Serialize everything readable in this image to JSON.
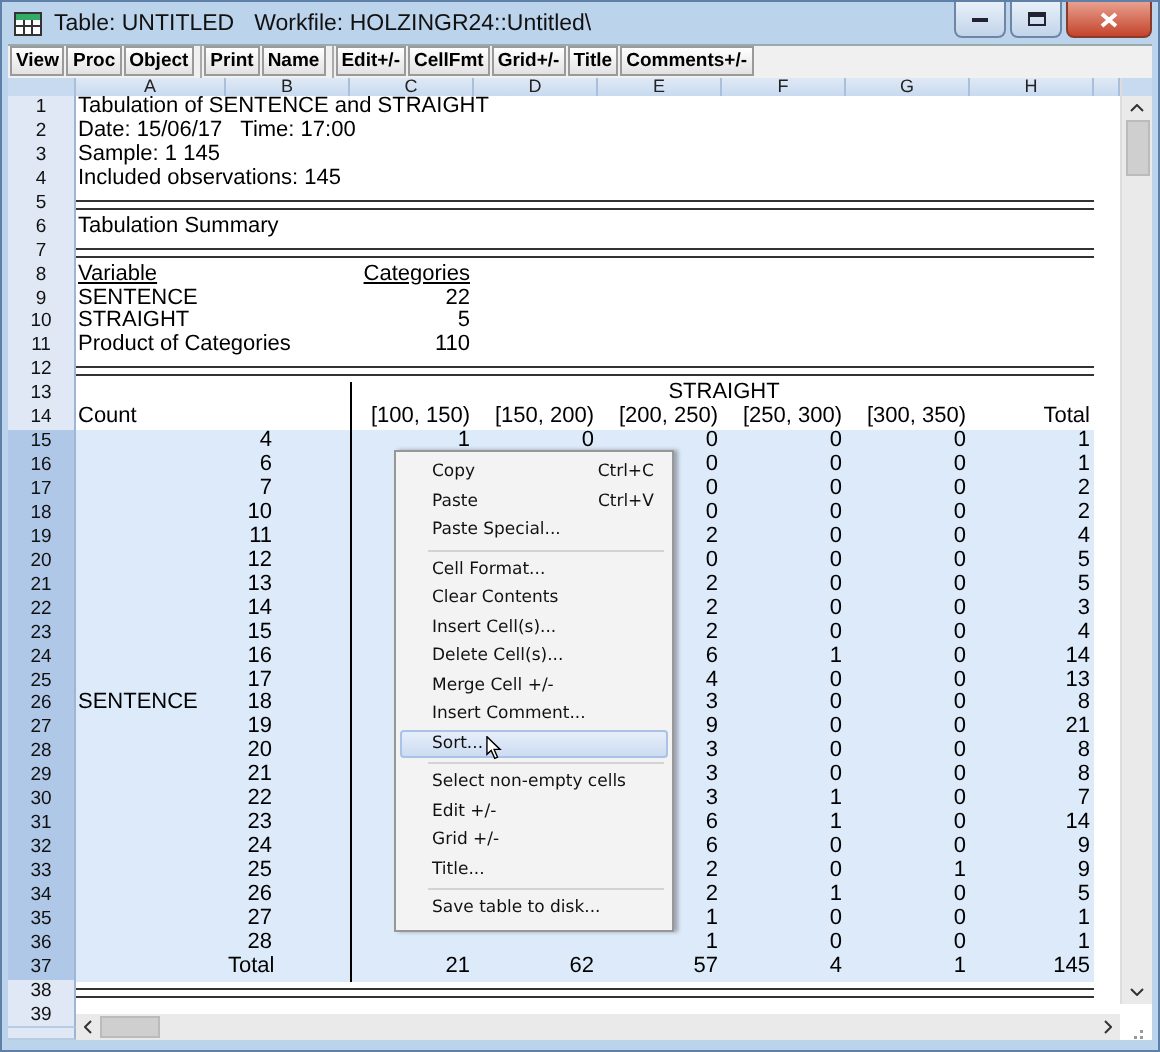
{
  "window": {
    "title": "Table: UNTITLED",
    "workfile": "Workfile: HOLZINGR24::Untitled\\"
  },
  "toolbar": [
    [
      "View",
      "Proc",
      "Object"
    ],
    [
      "Print",
      "Name"
    ],
    [
      "Edit+/-",
      "CellFmt",
      "Grid+/-",
      "Title",
      "Comments+/-"
    ]
  ],
  "column_headers": [
    "A",
    "B",
    "C",
    "D",
    "E",
    "F",
    "G",
    "H"
  ],
  "rows": [
    {
      "number": "1",
      "kind": "text",
      "text": "Tabulation of SENTENCE and STRAIGHT"
    },
    {
      "number": "2",
      "kind": "text",
      "text": "Date: 15/06/17   Time: 17:00"
    },
    {
      "number": "3",
      "kind": "text",
      "text": "Sample: 1 145"
    },
    {
      "number": "4",
      "kind": "text",
      "text": "Included observations: 145"
    },
    {
      "number": "5",
      "kind": "rule"
    },
    {
      "number": "6",
      "kind": "text",
      "text": "Tabulation Summary"
    },
    {
      "number": "7",
      "kind": "rule"
    },
    {
      "number": "8",
      "kind": "heading",
      "label": "Variable",
      "value": "Categories"
    },
    {
      "number": "9",
      "kind": "pair",
      "label": "SENTENCE",
      "value": "22"
    },
    {
      "number": "10",
      "kind": "pair",
      "label": "STRAIGHT",
      "value": "5"
    },
    {
      "number": "11",
      "kind": "pair",
      "label": "Product of Categories",
      "value": "110"
    },
    {
      "number": "12",
      "kind": "rule"
    },
    {
      "number": "13",
      "kind": "group_title",
      "text": "STRAIGHT"
    },
    {
      "number": "14",
      "kind": "column_titles",
      "label": "Count",
      "titles": [
        "[100, 150)",
        "[150, 200)",
        "[200, 250)",
        "[250, 300)",
        "[300, 350)",
        "Total"
      ]
    },
    {
      "number": "15",
      "kind": "data",
      "selected": true,
      "count": "4",
      "values_c_d": [
        "1",
        "0"
      ],
      "values_e_h": [
        "0",
        "0",
        "0",
        "1"
      ]
    },
    {
      "number": "16",
      "kind": "data",
      "selected": true,
      "count": "6",
      "values_e_h": [
        "0",
        "0",
        "0",
        "1"
      ]
    },
    {
      "number": "17",
      "kind": "data",
      "selected": true,
      "count": "7",
      "values_e_h": [
        "0",
        "0",
        "0",
        "2"
      ]
    },
    {
      "number": "18",
      "kind": "data",
      "selected": true,
      "count": "10",
      "values_e_h": [
        "0",
        "0",
        "0",
        "2"
      ]
    },
    {
      "number": "19",
      "kind": "data",
      "selected": true,
      "count": "11",
      "values_e_h": [
        "2",
        "0",
        "0",
        "4"
      ]
    },
    {
      "number": "20",
      "kind": "data",
      "selected": true,
      "count": "12",
      "values_e_h": [
        "0",
        "0",
        "0",
        "5"
      ]
    },
    {
      "number": "21",
      "kind": "data",
      "selected": true,
      "count": "13",
      "values_e_h": [
        "2",
        "0",
        "0",
        "5"
      ]
    },
    {
      "number": "22",
      "kind": "data",
      "selected": true,
      "count": "14",
      "values_e_h": [
        "2",
        "0",
        "0",
        "3"
      ]
    },
    {
      "number": "23",
      "kind": "data",
      "selected": true,
      "count": "15",
      "values_e_h": [
        "2",
        "0",
        "0",
        "4"
      ]
    },
    {
      "number": "24",
      "kind": "data",
      "selected": true,
      "count": "16",
      "values_e_h": [
        "6",
        "1",
        "0",
        "14"
      ]
    },
    {
      "number": "25",
      "kind": "data",
      "selected": true,
      "count": "17",
      "values_e_h": [
        "4",
        "0",
        "0",
        "13"
      ]
    },
    {
      "number": "26",
      "kind": "data",
      "selected": true,
      "label": "SENTENCE",
      "count": "18",
      "values_e_h": [
        "3",
        "0",
        "0",
        "8"
      ]
    },
    {
      "number": "27",
      "kind": "data",
      "selected": true,
      "count": "19",
      "values_e_h": [
        "9",
        "0",
        "0",
        "21"
      ]
    },
    {
      "number": "28",
      "kind": "data",
      "selected": true,
      "count": "20",
      "values_e_h": [
        "3",
        "0",
        "0",
        "8"
      ]
    },
    {
      "number": "29",
      "kind": "data",
      "selected": true,
      "count": "21",
      "values_e_h": [
        "3",
        "0",
        "0",
        "8"
      ]
    },
    {
      "number": "30",
      "kind": "data",
      "selected": true,
      "count": "22",
      "values_e_h": [
        "3",
        "1",
        "0",
        "7"
      ]
    },
    {
      "number": "31",
      "kind": "data",
      "selected": true,
      "count": "23",
      "values_e_h": [
        "6",
        "1",
        "0",
        "14"
      ]
    },
    {
      "number": "32",
      "kind": "data",
      "selected": true,
      "count": "24",
      "values_e_h": [
        "6",
        "0",
        "0",
        "9"
      ]
    },
    {
      "number": "33",
      "kind": "data",
      "selected": true,
      "count": "25",
      "values_e_h": [
        "2",
        "0",
        "1",
        "9"
      ]
    },
    {
      "number": "34",
      "kind": "data",
      "selected": true,
      "count": "26",
      "values_e_h": [
        "2",
        "1",
        "0",
        "5"
      ]
    },
    {
      "number": "35",
      "kind": "data",
      "selected": true,
      "count": "27",
      "values_e_h": [
        "1",
        "0",
        "0",
        "1"
      ]
    },
    {
      "number": "36",
      "kind": "data",
      "selected": true,
      "count": "28",
      "values_e_h": [
        "1",
        "0",
        "0",
        "1"
      ]
    },
    {
      "number": "37",
      "kind": "data",
      "selected": true,
      "count": "Total",
      "values_c_d": [
        "21",
        "62"
      ],
      "values_e_h": [
        "57",
        "4",
        "1",
        "145"
      ]
    },
    {
      "number": "38",
      "kind": "rule"
    },
    {
      "number": "39",
      "kind": "blank"
    }
  ],
  "context_menu": {
    "items": [
      {
        "kind": "item",
        "label": "Copy",
        "shortcut": "Ctrl+C",
        "selected": false
      },
      {
        "kind": "item",
        "label": "Paste",
        "shortcut": "Ctrl+V",
        "selected": false
      },
      {
        "kind": "item",
        "label": "Paste Special...",
        "selected": false
      },
      {
        "kind": "separator"
      },
      {
        "kind": "item",
        "label": "Cell Format...",
        "selected": false
      },
      {
        "kind": "item",
        "label": "Clear Contents",
        "selected": false
      },
      {
        "kind": "item",
        "label": "Insert Cell(s)...",
        "selected": false
      },
      {
        "kind": "item",
        "label": "Delete Cell(s)...",
        "selected": false
      },
      {
        "kind": "item",
        "label": "Merge Cell +/-",
        "selected": false
      },
      {
        "kind": "item",
        "label": "Insert Comment...",
        "selected": false
      },
      {
        "kind": "item",
        "label": "Sort...",
        "selected": true
      },
      {
        "kind": "separator"
      },
      {
        "kind": "item",
        "label": "Select non-empty cells",
        "selected": false
      },
      {
        "kind": "item",
        "label": "Edit +/-",
        "selected": false
      },
      {
        "kind": "item",
        "label": "Grid +/-",
        "selected": false
      },
      {
        "kind": "item",
        "label": "Title...",
        "selected": false
      },
      {
        "kind": "separator"
      },
      {
        "kind": "item",
        "label": "Save table to disk...",
        "selected": false
      }
    ]
  }
}
